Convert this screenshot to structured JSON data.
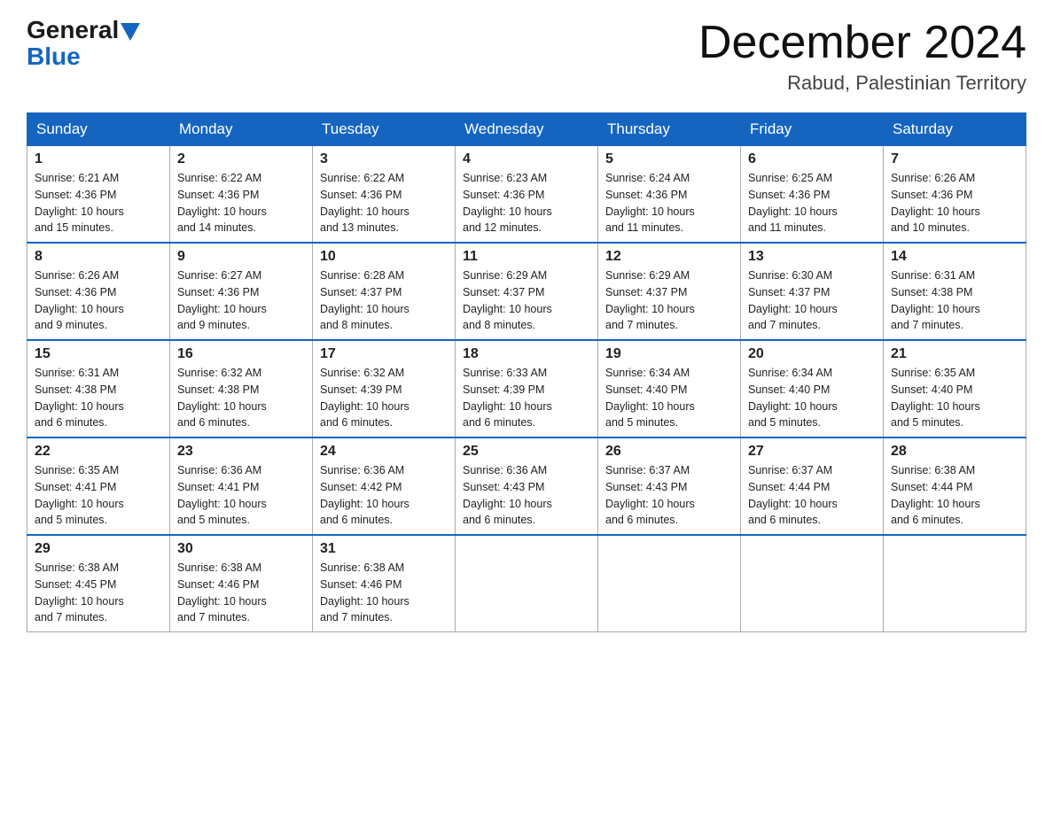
{
  "header": {
    "logo_general": "General",
    "logo_blue": "Blue",
    "month": "December 2024",
    "location": "Rabud, Palestinian Territory"
  },
  "days_of_week": [
    "Sunday",
    "Monday",
    "Tuesday",
    "Wednesday",
    "Thursday",
    "Friday",
    "Saturday"
  ],
  "weeks": [
    [
      {
        "day": "1",
        "sunrise": "6:21 AM",
        "sunset": "4:36 PM",
        "daylight": "10 hours and 15 minutes."
      },
      {
        "day": "2",
        "sunrise": "6:22 AM",
        "sunset": "4:36 PM",
        "daylight": "10 hours and 14 minutes."
      },
      {
        "day": "3",
        "sunrise": "6:22 AM",
        "sunset": "4:36 PM",
        "daylight": "10 hours and 13 minutes."
      },
      {
        "day": "4",
        "sunrise": "6:23 AM",
        "sunset": "4:36 PM",
        "daylight": "10 hours and 12 minutes."
      },
      {
        "day": "5",
        "sunrise": "6:24 AM",
        "sunset": "4:36 PM",
        "daylight": "10 hours and 11 minutes."
      },
      {
        "day": "6",
        "sunrise": "6:25 AM",
        "sunset": "4:36 PM",
        "daylight": "10 hours and 11 minutes."
      },
      {
        "day": "7",
        "sunrise": "6:26 AM",
        "sunset": "4:36 PM",
        "daylight": "10 hours and 10 minutes."
      }
    ],
    [
      {
        "day": "8",
        "sunrise": "6:26 AM",
        "sunset": "4:36 PM",
        "daylight": "10 hours and 9 minutes."
      },
      {
        "day": "9",
        "sunrise": "6:27 AM",
        "sunset": "4:36 PM",
        "daylight": "10 hours and 9 minutes."
      },
      {
        "day": "10",
        "sunrise": "6:28 AM",
        "sunset": "4:37 PM",
        "daylight": "10 hours and 8 minutes."
      },
      {
        "day": "11",
        "sunrise": "6:29 AM",
        "sunset": "4:37 PM",
        "daylight": "10 hours and 8 minutes."
      },
      {
        "day": "12",
        "sunrise": "6:29 AM",
        "sunset": "4:37 PM",
        "daylight": "10 hours and 7 minutes."
      },
      {
        "day": "13",
        "sunrise": "6:30 AM",
        "sunset": "4:37 PM",
        "daylight": "10 hours and 7 minutes."
      },
      {
        "day": "14",
        "sunrise": "6:31 AM",
        "sunset": "4:38 PM",
        "daylight": "10 hours and 7 minutes."
      }
    ],
    [
      {
        "day": "15",
        "sunrise": "6:31 AM",
        "sunset": "4:38 PM",
        "daylight": "10 hours and 6 minutes."
      },
      {
        "day": "16",
        "sunrise": "6:32 AM",
        "sunset": "4:38 PM",
        "daylight": "10 hours and 6 minutes."
      },
      {
        "day": "17",
        "sunrise": "6:32 AM",
        "sunset": "4:39 PM",
        "daylight": "10 hours and 6 minutes."
      },
      {
        "day": "18",
        "sunrise": "6:33 AM",
        "sunset": "4:39 PM",
        "daylight": "10 hours and 6 minutes."
      },
      {
        "day": "19",
        "sunrise": "6:34 AM",
        "sunset": "4:40 PM",
        "daylight": "10 hours and 5 minutes."
      },
      {
        "day": "20",
        "sunrise": "6:34 AM",
        "sunset": "4:40 PM",
        "daylight": "10 hours and 5 minutes."
      },
      {
        "day": "21",
        "sunrise": "6:35 AM",
        "sunset": "4:40 PM",
        "daylight": "10 hours and 5 minutes."
      }
    ],
    [
      {
        "day": "22",
        "sunrise": "6:35 AM",
        "sunset": "4:41 PM",
        "daylight": "10 hours and 5 minutes."
      },
      {
        "day": "23",
        "sunrise": "6:36 AM",
        "sunset": "4:41 PM",
        "daylight": "10 hours and 5 minutes."
      },
      {
        "day": "24",
        "sunrise": "6:36 AM",
        "sunset": "4:42 PM",
        "daylight": "10 hours and 6 minutes."
      },
      {
        "day": "25",
        "sunrise": "6:36 AM",
        "sunset": "4:43 PM",
        "daylight": "10 hours and 6 minutes."
      },
      {
        "day": "26",
        "sunrise": "6:37 AM",
        "sunset": "4:43 PM",
        "daylight": "10 hours and 6 minutes."
      },
      {
        "day": "27",
        "sunrise": "6:37 AM",
        "sunset": "4:44 PM",
        "daylight": "10 hours and 6 minutes."
      },
      {
        "day": "28",
        "sunrise": "6:38 AM",
        "sunset": "4:44 PM",
        "daylight": "10 hours and 6 minutes."
      }
    ],
    [
      {
        "day": "29",
        "sunrise": "6:38 AM",
        "sunset": "4:45 PM",
        "daylight": "10 hours and 7 minutes."
      },
      {
        "day": "30",
        "sunrise": "6:38 AM",
        "sunset": "4:46 PM",
        "daylight": "10 hours and 7 minutes."
      },
      {
        "day": "31",
        "sunrise": "6:38 AM",
        "sunset": "4:46 PM",
        "daylight": "10 hours and 7 minutes."
      },
      null,
      null,
      null,
      null
    ]
  ],
  "labels": {
    "sunrise": "Sunrise:",
    "sunset": "Sunset:",
    "daylight": "Daylight:"
  }
}
